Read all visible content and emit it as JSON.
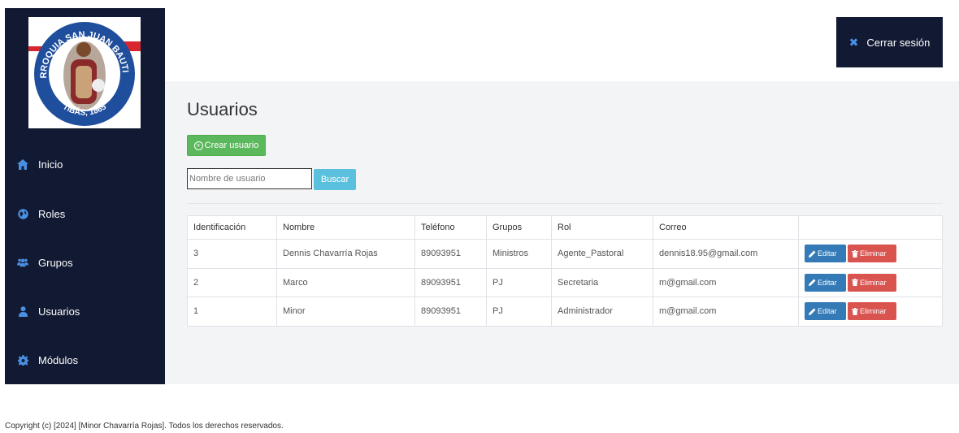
{
  "sidebar": {
    "logo": {
      "icon": "parish-seal-logo",
      "text_top": "PARROQUIA SAN JUAN BAUTISTA",
      "text_bottom": "TIBÁS, 1865"
    },
    "items": [
      {
        "label": "Inicio",
        "icon": "home-icon"
      },
      {
        "label": "Roles",
        "icon": "globe-icon"
      },
      {
        "label": "Grupos",
        "icon": "users-icon"
      },
      {
        "label": "Usuarios",
        "icon": "user-icon"
      },
      {
        "label": "Módulos",
        "icon": "gear-icon"
      }
    ]
  },
  "header": {
    "logout_label": "Cerrar sesión",
    "logout_icon": "close-icon"
  },
  "main": {
    "title": "Usuarios",
    "create_label": "Crear usuario",
    "search": {
      "placeholder": "Nombre de usuario",
      "value": ""
    },
    "search_button": "Buscar"
  },
  "table": {
    "headers": [
      "Identificación",
      "Nombre",
      "Teléfono",
      "Grupos",
      "Rol",
      "Correo",
      ""
    ],
    "edit_label": "Editar",
    "delete_label": "Eliminar",
    "rows": [
      [
        "3",
        "Dennis Chavarría Rojas",
        "89093951",
        "Ministros",
        "Agente_Pastoral",
        "dennis18.95@gmail.com"
      ],
      [
        "2",
        "Marco",
        "89093951",
        "PJ",
        "Secretaria",
        "m@gmail.com"
      ],
      [
        "1",
        "Minor",
        "89093951",
        "PJ",
        "Administrador",
        "m@gmail.com"
      ]
    ]
  },
  "footer": {
    "text": "Copyright (c) [2024] [Minor Chavarría Rojas]. Todos los derechos reservados."
  },
  "colors": {
    "sidebar_bg": "#121a33",
    "create_button": "#5cb85c",
    "search_button": "#5bc0de",
    "edit_button": "#337ab7",
    "delete_button": "#d9534f"
  }
}
